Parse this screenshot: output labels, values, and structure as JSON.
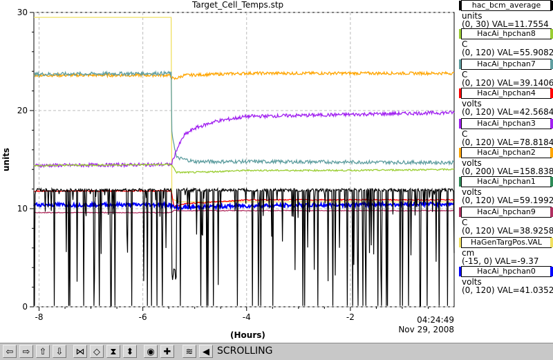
{
  "title": "Target_Cell_Temps.stp",
  "y_axis_label": "units",
  "x_axis_label": "(Hours)",
  "timestamp": {
    "time": "04:24:49",
    "date": "Nov 29, 2008"
  },
  "legend": [
    {
      "name": "hac_bcm_average",
      "unit": "units",
      "range": "(0, 30) VAL=11.7554",
      "color": "#000000"
    },
    {
      "name": "HacAi_hpchan8",
      "unit": "C",
      "range": "(0, 120) VAL=55.9082",
      "color": "#9acd32"
    },
    {
      "name": "HacAi_hpchan7",
      "unit": "C",
      "range": "(0, 120) VAL=39.1406",
      "color": "#5f9ea0"
    },
    {
      "name": "HacAi_hpchan4",
      "unit": "volts",
      "range": "(0, 120) VAL=42.5684",
      "color": "#ff0000"
    },
    {
      "name": "HacAi_hpchan3",
      "unit": "C",
      "range": "(0, 120) VAL=78.8184",
      "color": "#a020f0"
    },
    {
      "name": "HacAi_hpchan2",
      "unit": "volts",
      "range": "(0, 200) VAL=158.838",
      "color": "#ffa500"
    },
    {
      "name": "HacAi_hpchan1",
      "unit": "volts",
      "range": "(0, 120) VAL=59.1992",
      "color": "#2e8b57"
    },
    {
      "name": "HacAi_hpchan9",
      "unit": "C",
      "range": "(0, 120) VAL=38.9258",
      "color": "#b03060"
    },
    {
      "name": "HaGenTargPos.VAL",
      "unit": "cm",
      "range": "(-15, 0) VAL=-9.37",
      "color": "#f0e060"
    },
    {
      "name": "HacAi_hpchan0",
      "unit": "volts",
      "range": "(0, 120) VAL=41.0352",
      "color": "#0000ff"
    }
  ],
  "toolbar": {
    "status": "SCROLLING",
    "buttons": [
      {
        "name": "scroll-left-icon",
        "glyph": "⇦"
      },
      {
        "name": "scroll-right-icon",
        "glyph": "⇨"
      },
      {
        "name": "scroll-up-icon",
        "glyph": "⇧"
      },
      {
        "name": "scroll-down-icon",
        "glyph": "⇩"
      },
      {
        "name": "zoom-in-x-icon",
        "glyph": "⋈"
      },
      {
        "name": "zoom-out-x-icon",
        "glyph": "◇"
      },
      {
        "name": "zoom-in-y-icon",
        "glyph": "⧗"
      },
      {
        "name": "zoom-out-y-icon",
        "glyph": "⬍"
      },
      {
        "name": "record-icon",
        "glyph": "◉"
      },
      {
        "name": "crosshair-icon",
        "glyph": "✚"
      },
      {
        "name": "autoscale-icon",
        "glyph": "≋"
      },
      {
        "name": "back-icon",
        "glyph": "◀"
      }
    ]
  },
  "chart_data": {
    "type": "line",
    "title": "Target_Cell_Temps.stp",
    "xlabel": "(Hours)",
    "ylabel": "units",
    "xlim": [
      -8.1,
      0
    ],
    "ylim": [
      0,
      30
    ],
    "xticks": [
      -8,
      -6,
      -4,
      -2
    ],
    "yticks": [
      0,
      10,
      20,
      30
    ],
    "grid": true,
    "legend_position": "right",
    "series": [
      {
        "name": "HaGenTargPos.VAL",
        "color": "#f0e060",
        "points": [
          [
            -8.1,
            29.5
          ],
          [
            -5.45,
            29.5
          ],
          [
            -5.45,
            11.0
          ],
          [
            -5.3,
            10.7
          ],
          [
            0,
            10.7
          ]
        ]
      },
      {
        "name": "HacAi_hpchan2",
        "color": "#ffa500",
        "points": [
          [
            -8.1,
            23.6
          ],
          [
            -5.5,
            23.6
          ],
          [
            -5.4,
            23.2
          ],
          [
            -5.2,
            23.6
          ],
          [
            -4.0,
            23.8
          ],
          [
            0,
            23.8
          ]
        ]
      },
      {
        "name": "HacAi_hpchan7",
        "color": "#5f9ea0",
        "points": [
          [
            -8.1,
            23.7
          ],
          [
            -5.45,
            23.8
          ],
          [
            -5.45,
            18.0
          ],
          [
            -5.35,
            15.2
          ],
          [
            -5.0,
            14.8
          ],
          [
            -4.0,
            14.8
          ],
          [
            0,
            14.7
          ]
        ]
      },
      {
        "name": "HacAi_hpchan3",
        "color": "#a020f0",
        "points": [
          [
            -8.1,
            14.4
          ],
          [
            -5.45,
            14.5
          ],
          [
            -5.35,
            16.0
          ],
          [
            -5.2,
            17.5
          ],
          [
            -5.0,
            18.2
          ],
          [
            -4.6,
            18.9
          ],
          [
            -4.0,
            19.4
          ],
          [
            -3.0,
            19.5
          ],
          [
            -2.0,
            19.6
          ],
          [
            -1.0,
            19.7
          ],
          [
            0,
            19.8
          ]
        ]
      },
      {
        "name": "HacAi_hpchan8",
        "color": "#9acd32",
        "points": [
          [
            -8.1,
            14.4
          ],
          [
            -5.45,
            14.5
          ],
          [
            -5.35,
            13.7
          ],
          [
            -5.0,
            13.7
          ],
          [
            -4.0,
            13.9
          ],
          [
            -2.0,
            13.9
          ],
          [
            0,
            14.0
          ]
        ]
      },
      {
        "name": "HacAi_hpchan4",
        "color": "#ff0000",
        "points": [
          [
            -8.1,
            11.8
          ],
          [
            -5.45,
            11.8
          ],
          [
            -5.4,
            10.2
          ],
          [
            -5.2,
            10.5
          ],
          [
            -4.0,
            10.9
          ],
          [
            0,
            10.9
          ]
        ]
      },
      {
        "name": "HacAi_hpchan0",
        "color": "#0000ff",
        "points": [
          [
            -8.1,
            10.4
          ],
          [
            -5.45,
            10.4
          ],
          [
            -5.4,
            10.1
          ],
          [
            -4.0,
            10.3
          ],
          [
            -2.0,
            10.4
          ],
          [
            0,
            10.5
          ]
        ]
      },
      {
        "name": "HacAi_hpchan9",
        "color": "#b03060",
        "points": [
          [
            -8.1,
            9.6
          ],
          [
            -5.45,
            9.6
          ],
          [
            -5.4,
            9.8
          ],
          [
            0,
            9.8
          ]
        ]
      },
      {
        "name": "hac_bcm_average",
        "color": "#000000",
        "pattern": "beam current: mostly ~11.9 with frequent dropouts to 0 (noisy)"
      }
    ]
  }
}
